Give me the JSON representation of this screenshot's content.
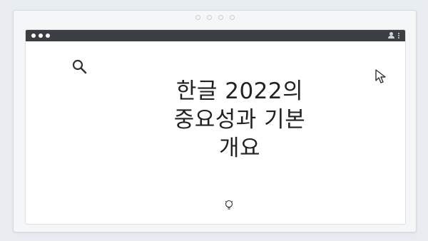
{
  "window": {
    "controls": [
      "close",
      "minimize",
      "maximize"
    ],
    "right_icons": [
      "profile-icon",
      "kebab-menu-icon"
    ]
  },
  "main": {
    "headline_lines": [
      "한글 2022의",
      "중요성과 기본",
      "개요"
    ]
  },
  "icons": {
    "search": "search-icon",
    "cursor": "cursor-icon",
    "bulb": "lightbulb-icon"
  },
  "colors": {
    "titlebar": "#3b3f44",
    "background": "#e8ecf0",
    "text": "#222222"
  }
}
